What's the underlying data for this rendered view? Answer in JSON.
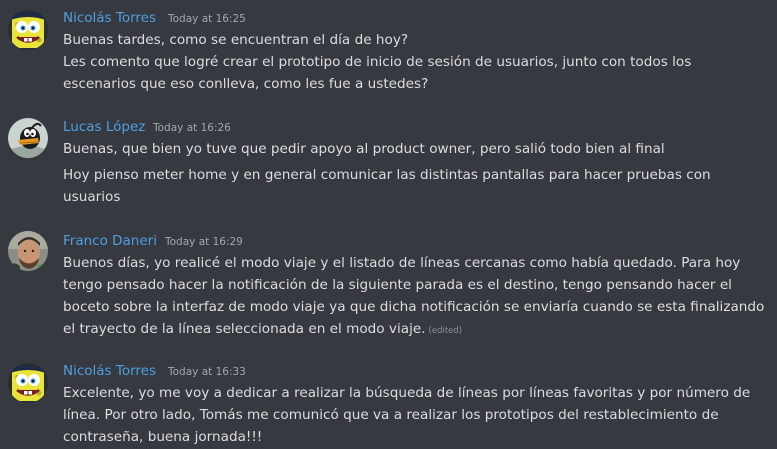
{
  "colors": {
    "background": "#36393f",
    "username": "#4f9fe0",
    "text": "#dcddde",
    "timestamp": "#a3a6aa"
  },
  "messages": [
    {
      "author": "Nicolás Torres",
      "avatar_icon": "sponge-character-icon",
      "timestamp": "Today at 16:25",
      "lines": [
        "Buenas tardes, como se encuentran el día de hoy?",
        "Les comento que logré crear el prototipo de inicio de sesión de usuarios, junto con todos los",
        "escenarios que eso conlleva, como les fue a ustedes?"
      ]
    },
    {
      "author": "Lucas López",
      "avatar_icon": "cartoon-duck-icon",
      "timestamp": "Today at 16:26",
      "lines": [
        "Buenas, que bien yo tuve que pedir apoyo al product owner, pero salió todo bien al final",
        "Hoy pienso meter home y en general comunicar las distintas pantallas para hacer pruebas con",
        "usuarios"
      ]
    },
    {
      "author": "Franco Daneri",
      "avatar_icon": "user-photo-icon",
      "timestamp": "Today at 16:29",
      "lines": [
        "Buenos días, yo realicé el modo viaje y el listado de líneas cercanas como había quedado. Para hoy",
        "tengo pensado hacer la notificación de la siguiente parada es el destino, tengo pensando hacer el",
        "boceto sobre la interfaz de modo viaje ya que dicha notificación se enviaría cuando se esta finalizando",
        "el trayecto de la línea seleccionada en el modo viaje."
      ],
      "edited_label": "(edited)"
    },
    {
      "author": "Nicolás Torres",
      "avatar_icon": "sponge-character-icon",
      "timestamp": "Today at 16:33",
      "lines": [
        "Excelente, yo me voy a dedicar a realizar la búsqueda de líneas por líneas favoritas y por número de",
        "línea. Por otro lado, Tomás me comunicó que va a realizar los prototipos del restablecimiento de",
        "contraseña, buena jornada!!!"
      ]
    }
  ]
}
